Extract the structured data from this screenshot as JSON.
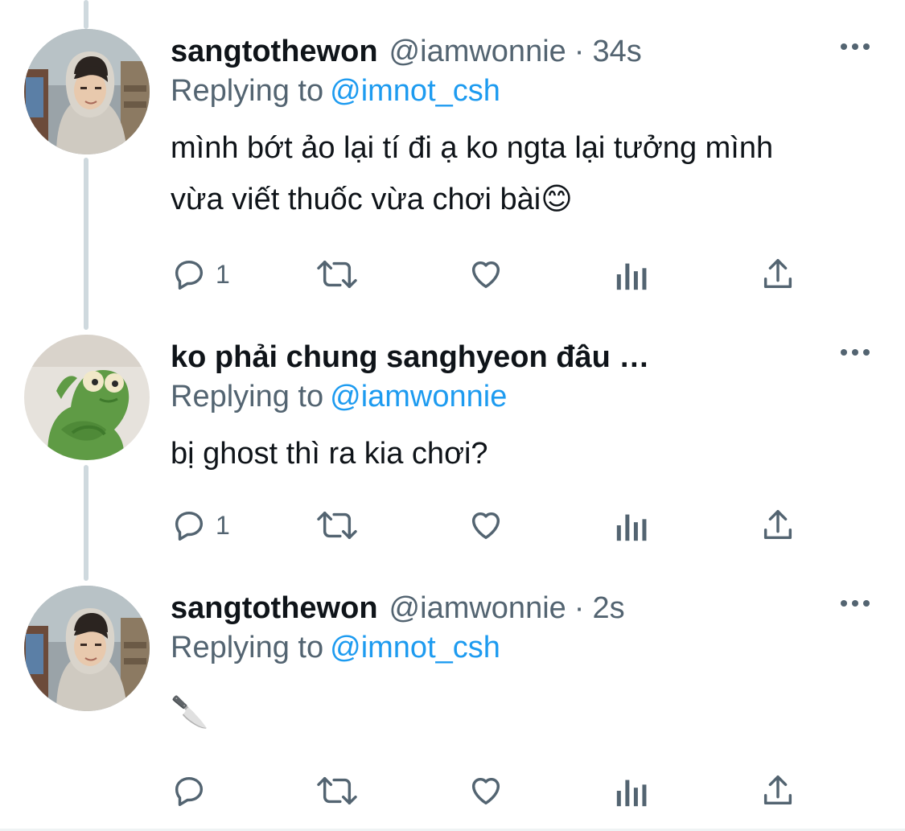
{
  "tweets": [
    {
      "name": "sangtothewon",
      "handle": "@iamwonnie",
      "separator": "·",
      "time": "34s",
      "replying_label": "Replying to",
      "replying_to": "@imnot_csh",
      "text": "mình bớt ảo lại tí đi ạ ko ngta lại tưởng mình\nvừa viết thuốc vừa chơi bài😊",
      "reply_count": "1",
      "avatar": "person-in-hoodie"
    },
    {
      "name": "ko phải chung sanghyeon đâu …",
      "handle": "",
      "separator": "",
      "time": "",
      "replying_label": "Replying to",
      "replying_to": "@iamwonnie",
      "text": "bị ghost thì ra kia chơi?",
      "reply_count": "1",
      "avatar": "green-frog-plush"
    },
    {
      "name": "sangtothewon",
      "handle": "@iamwonnie",
      "separator": "·",
      "time": "2s",
      "replying_label": "Replying to",
      "replying_to": "@imnot_csh",
      "text": "🔪",
      "reply_count": "",
      "avatar": "person-in-hoodie"
    }
  ],
  "colors": {
    "text": "#0f1419",
    "secondary": "#536471",
    "link": "#1d9bf0",
    "thread_line": "#cfd9de"
  },
  "icons": [
    "reply-icon",
    "retweet-icon",
    "like-icon",
    "analytics-icon",
    "share-icon",
    "more-icon"
  ]
}
